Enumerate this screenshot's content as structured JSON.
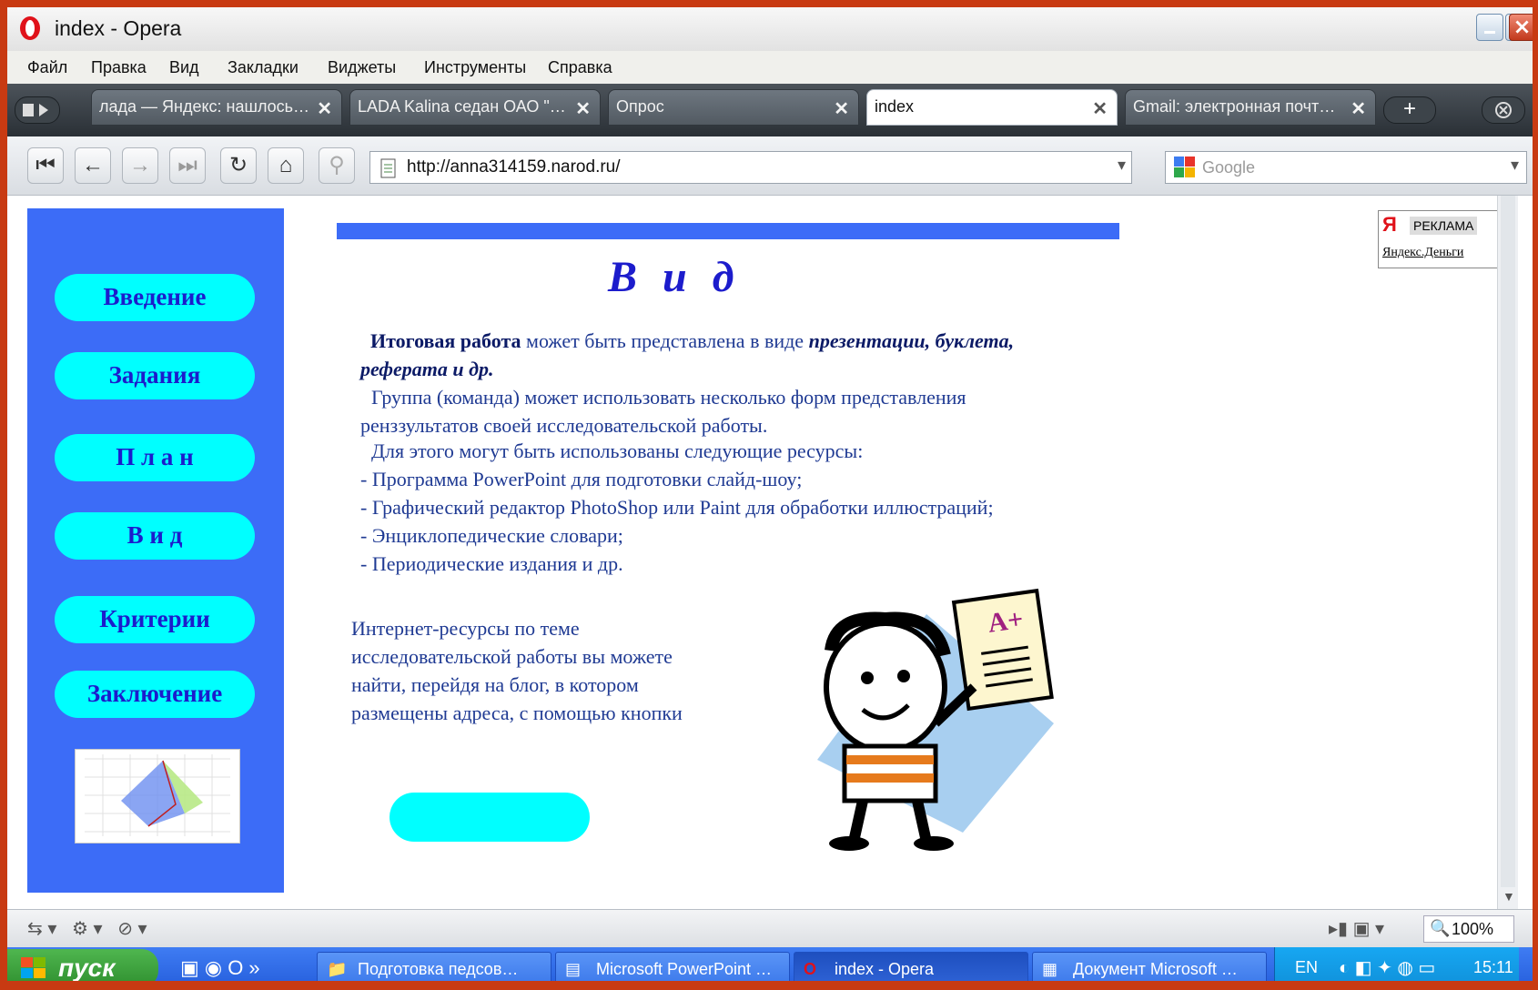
{
  "window": {
    "title": "index - Opera"
  },
  "menu": [
    "Файл",
    "Правка",
    "Вид",
    "Закладки",
    "Виджеты",
    "Инструменты",
    "Справка"
  ],
  "tabs": [
    {
      "label": "лада — Яндекс: нашлось…",
      "active": false
    },
    {
      "label": "LADA Kalina седан ОАО \"…",
      "active": false
    },
    {
      "label": "Опрос",
      "active": false
    },
    {
      "label": "index",
      "active": true
    },
    {
      "label": "Gmail: электронная почт…",
      "active": false
    }
  ],
  "address": {
    "url": "http://anna314159.narod.ru/"
  },
  "search": {
    "placeholder": "Google"
  },
  "sidebar": {
    "items": [
      "Введение",
      "Задания",
      "П л а н",
      "В и д",
      "Критерии",
      "Заключение"
    ]
  },
  "page": {
    "heading": "В и д",
    "p1_bold": "Итоговая работа",
    "p1_text": " может быть представлена в  виде ",
    "p1_em": "презентации, буклета, реферата и др.",
    "p2": "Группа (команда) может использовать несколько форм представления ренззультатов своей исследовательской работы.",
    "p3": "Для этого могут быть использованы следующие ресурсы:",
    "bullets": [
      "- Программа PowerPoint для подготовки слайд-шоу;",
      "- Графический редактор PhotoShop или Paint для обработки иллюстраций;",
      "- Энциклопедические словари;",
      "- Периодические издания и др."
    ],
    "internet_text": "Интернет-ресурсы  по теме исследовательской работы вы можете найти, перейдя на блог, в котором размещены адреса, с помощью кнопки"
  },
  "ad": {
    "label": "РЕКЛАМА",
    "link": "Яндекс.Деньги"
  },
  "status": {
    "zoom": "100%"
  },
  "taskbar": {
    "start": "пуск",
    "tasks": [
      {
        "label": "Подготовка педсов…",
        "active": false
      },
      {
        "label": "Microsoft PowerPoint …",
        "active": false
      },
      {
        "label": "index - Opera",
        "active": true
      },
      {
        "label": "Документ Microsoft …",
        "active": false
      }
    ],
    "lang": "EN",
    "time": "15:11"
  },
  "colors": {
    "frame": "#c83a12",
    "sidebar": "#3c6cf7",
    "pill": "#00ffff",
    "heading": "#1c1ccc"
  }
}
